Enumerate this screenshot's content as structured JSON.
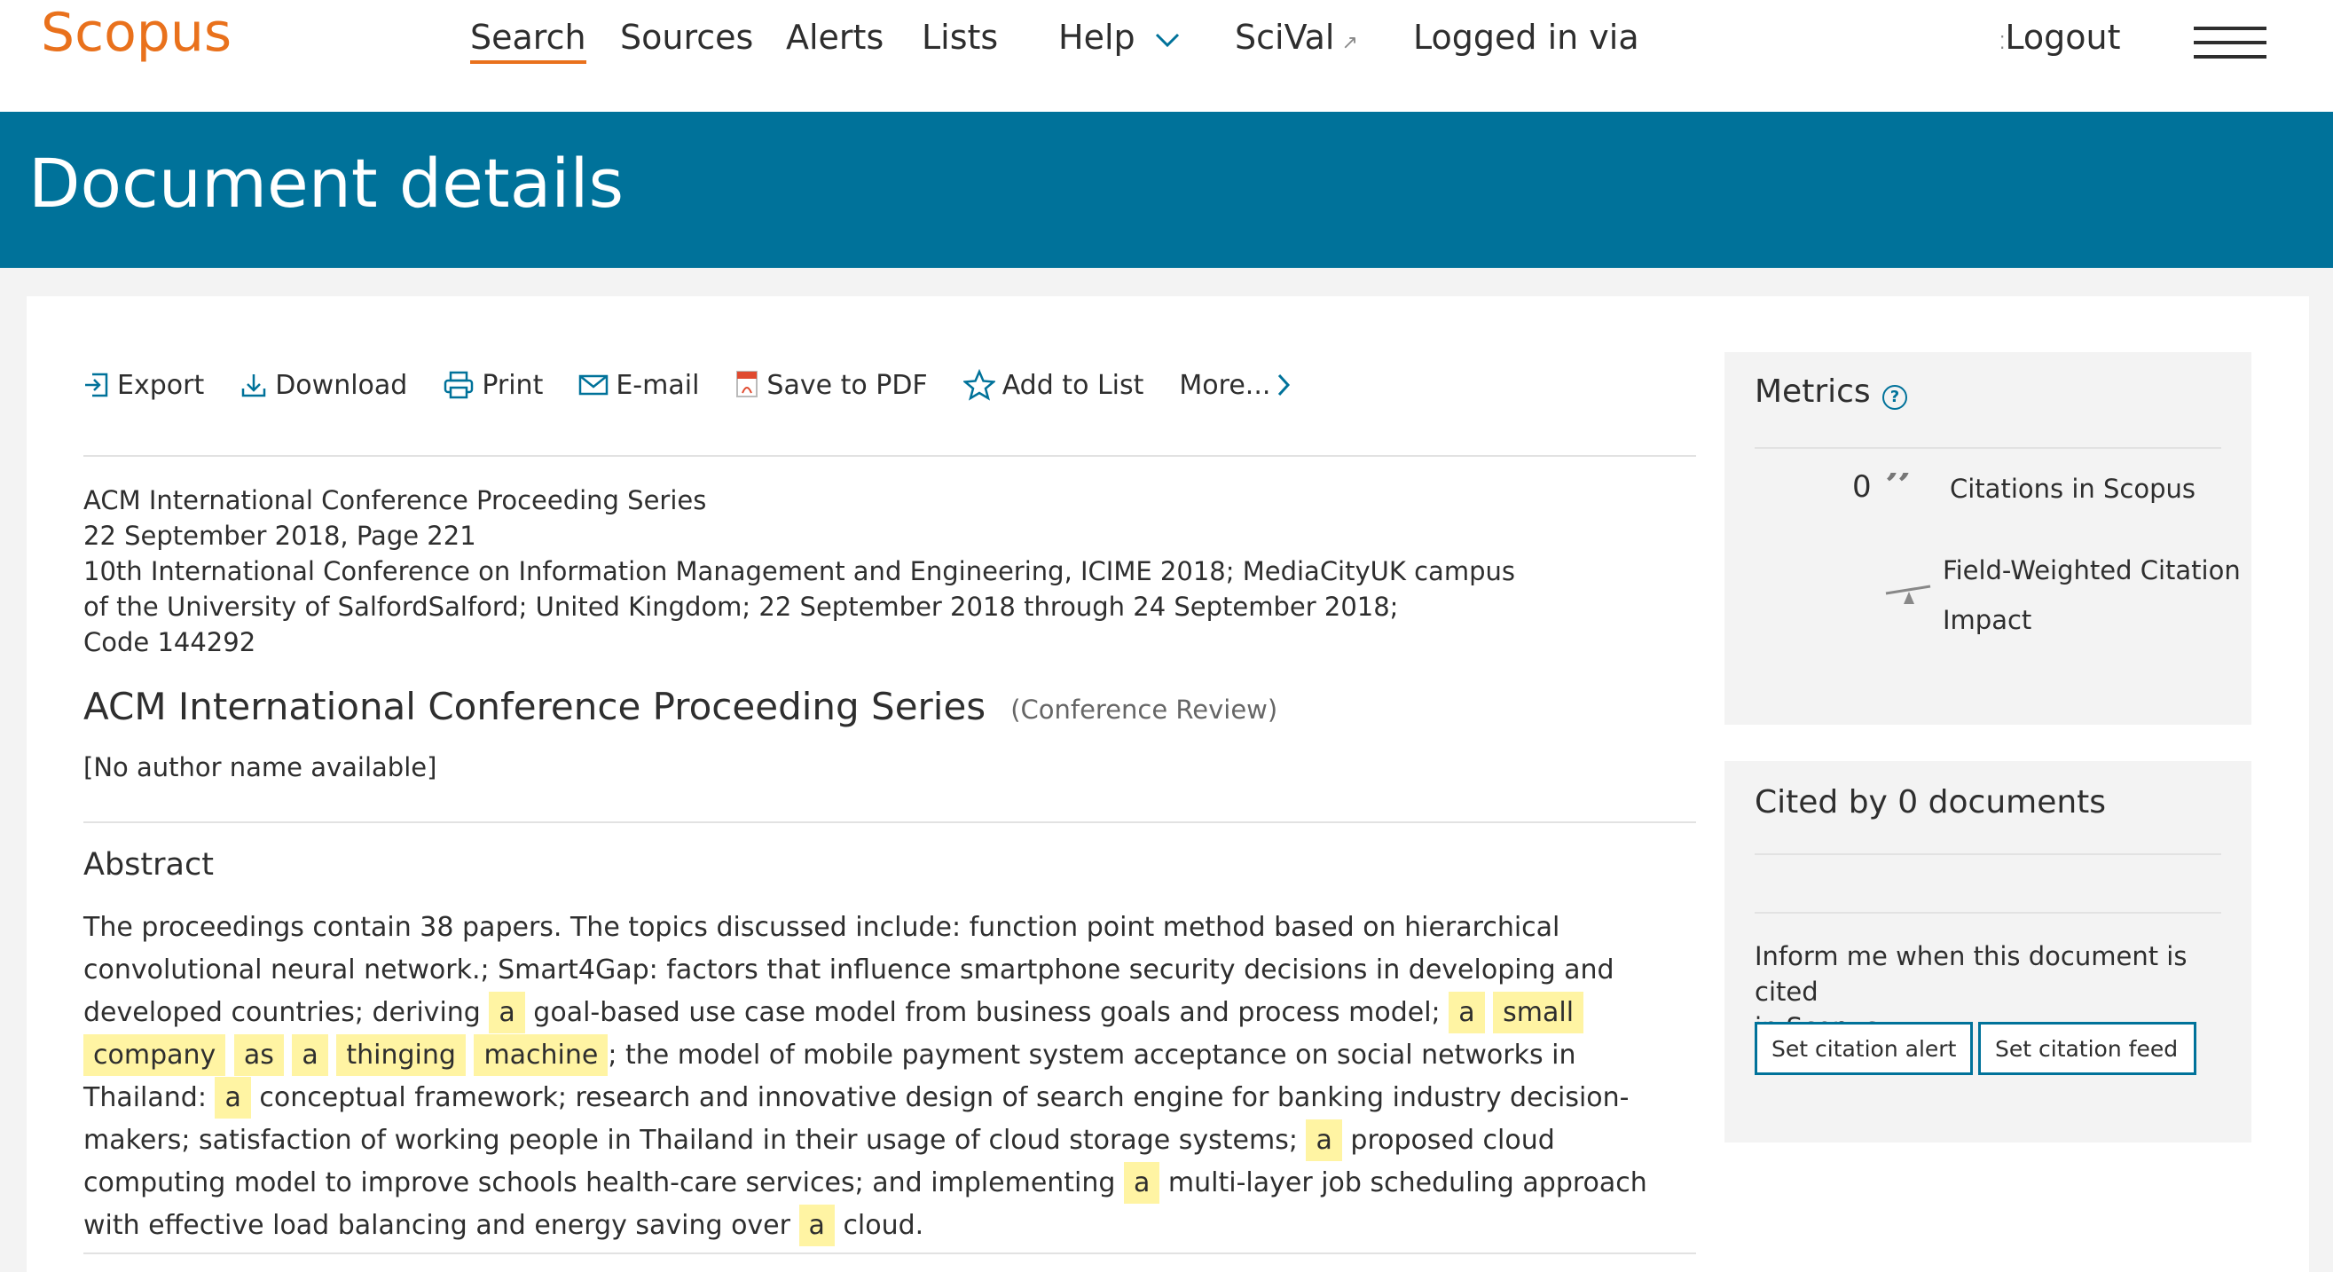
{
  "nav": {
    "logo": "Scopus",
    "items": [
      "Search",
      "Sources",
      "Alerts",
      "Lists",
      "Help",
      "SciVal",
      "Logged in via",
      "Logout"
    ]
  },
  "banner": {
    "title": "Document details"
  },
  "toolbar": {
    "export": "Export",
    "download": "Download",
    "print": "Print",
    "email": "E-mail",
    "save_pdf": "Save to PDF",
    "add_list": "Add to List",
    "more": "More..."
  },
  "document": {
    "source_lines": [
      "ACM International Conference Proceeding Series",
      "22 September 2018, Page 221",
      "10th International Conference on Information Management and Engineering, ICIME 2018; MediaCityUK campus",
      "of the University of SalfordSalford; United Kingdom; 22 September 2018 through 24 September 2018;",
      "Code 144292"
    ],
    "title": "ACM International Conference Proceeding Series",
    "doc_type": "(Conference Review)",
    "authors": "[No author name available]"
  },
  "abstract": {
    "heading": "Abstract",
    "parts": [
      {
        "t": "The proceedings contain 38 papers. The topics discussed include: function point method based on hierarchical convolutional neural network.; Smart4Gap: factors that influence smartphone security decisions in developing and developed countries; deriving ",
        "hl": false
      },
      {
        "t": "a",
        "hl": true
      },
      {
        "t": " goal-based use case model from business goals and process model; ",
        "hl": false
      },
      {
        "t": "a",
        "hl": true
      },
      {
        "t": " ",
        "hl": false
      },
      {
        "t": "small",
        "hl": true
      },
      {
        "t": " ",
        "hl": false
      },
      {
        "t": "company",
        "hl": true
      },
      {
        "t": " ",
        "hl": false
      },
      {
        "t": "as",
        "hl": true
      },
      {
        "t": " ",
        "hl": false
      },
      {
        "t": "a",
        "hl": true
      },
      {
        "t": " ",
        "hl": false
      },
      {
        "t": "thinging",
        "hl": true
      },
      {
        "t": " ",
        "hl": false
      },
      {
        "t": "machine",
        "hl": true
      },
      {
        "t": "; the model of mobile payment system acceptance on social networks in Thailand: ",
        "hl": false
      },
      {
        "t": "a",
        "hl": true
      },
      {
        "t": " conceptual framework; research and innovative design of search engine for banking industry decision-makers; satisfaction of working people in Thailand in their usage of cloud storage systems; ",
        "hl": false
      },
      {
        "t": "a",
        "hl": true
      },
      {
        "t": " proposed cloud computing model to improve schools health-care services; and implementing ",
        "hl": false
      },
      {
        "t": "a",
        "hl": true
      },
      {
        "t": " multi-layer job scheduling approach with effective load balancing and energy saving over ",
        "hl": false
      },
      {
        "t": "a",
        "hl": true
      },
      {
        "t": " cloud.",
        "hl": false
      }
    ]
  },
  "metrics": {
    "title": "Metrics",
    "citations_count": "0",
    "citations_label": "Citations in Scopus",
    "fwci_label_1": "Field-Weighted Citation",
    "fwci_label_2": "Impact"
  },
  "cited_by": {
    "title": "Cited by 0 documents",
    "inform_line_1": "Inform me when this document is cited",
    "inform_line_2": "in Scopus:",
    "alert_button": "Set citation alert",
    "feed_button": "Set citation feed"
  },
  "colors": {
    "brand_orange": "#e9711c",
    "banner_blue": "#00729a",
    "highlight": "#fff4a3"
  }
}
